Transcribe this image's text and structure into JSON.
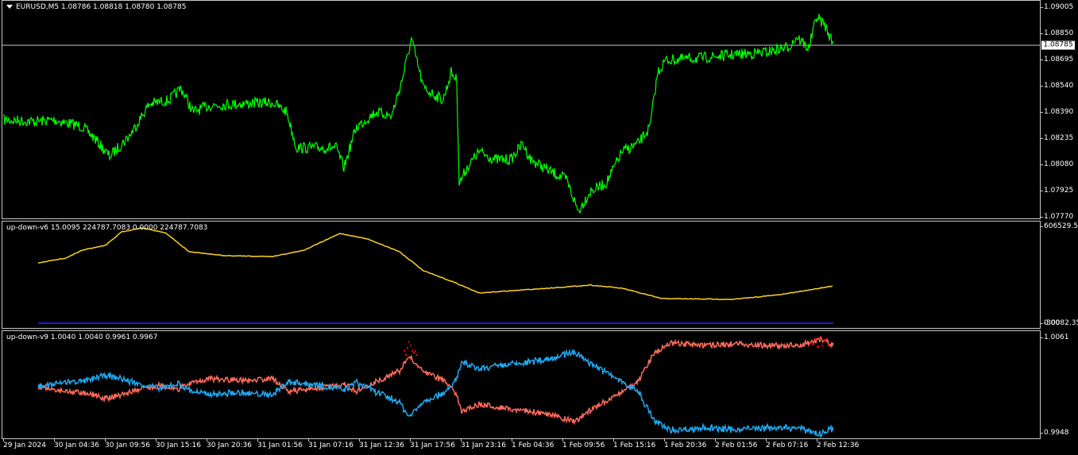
{
  "main": {
    "symbol_label": "EURUSD,M5  1.08786 1.08818 1.08780 1.08785",
    "current_price": "1.08785",
    "y_ticks": [
      "1.09005",
      "1.08850",
      "1.08695",
      "1.08540",
      "1.08390",
      "1.08235",
      "1.08080",
      "1.07925",
      "1.07770"
    ],
    "line_color": "#00ff00"
  },
  "ind1": {
    "label": "up-down-v6 15.0095 224787.7083 0.0000 224787.7083",
    "y_top": "606529.50",
    "y_bottom": "-30082.35",
    "y_zero": "0.00",
    "line_color": "#ffd21f",
    "base_color": "#1030ff"
  },
  "ind2": {
    "label": "up-down-v9 1.0040 1.0040 0.9961 0.9967",
    "y_top": "1.0061",
    "y_bottom": "0.9948",
    "red_color": "#ff6b5b",
    "blue_color": "#1fa8f0",
    "marker_color": "#ff0000"
  },
  "x_axis": {
    "labels": [
      "29 Jan 2024",
      "30 Jan 04:36",
      "30 Jan 09:56",
      "30 Jan 15:16",
      "30 Jan 20:36",
      "31 Jan 01:56",
      "31 Jan 07:16",
      "31 Jan 12:36",
      "31 Jan 17:56",
      "31 Jan 23:16",
      "1 Feb 04:36",
      "1 Feb 09:56",
      "1 Feb 15:16",
      "1 Feb 20:36",
      "2 Feb 01:56",
      "2 Feb 07:16",
      "2 Feb 12:36"
    ]
  }
}
